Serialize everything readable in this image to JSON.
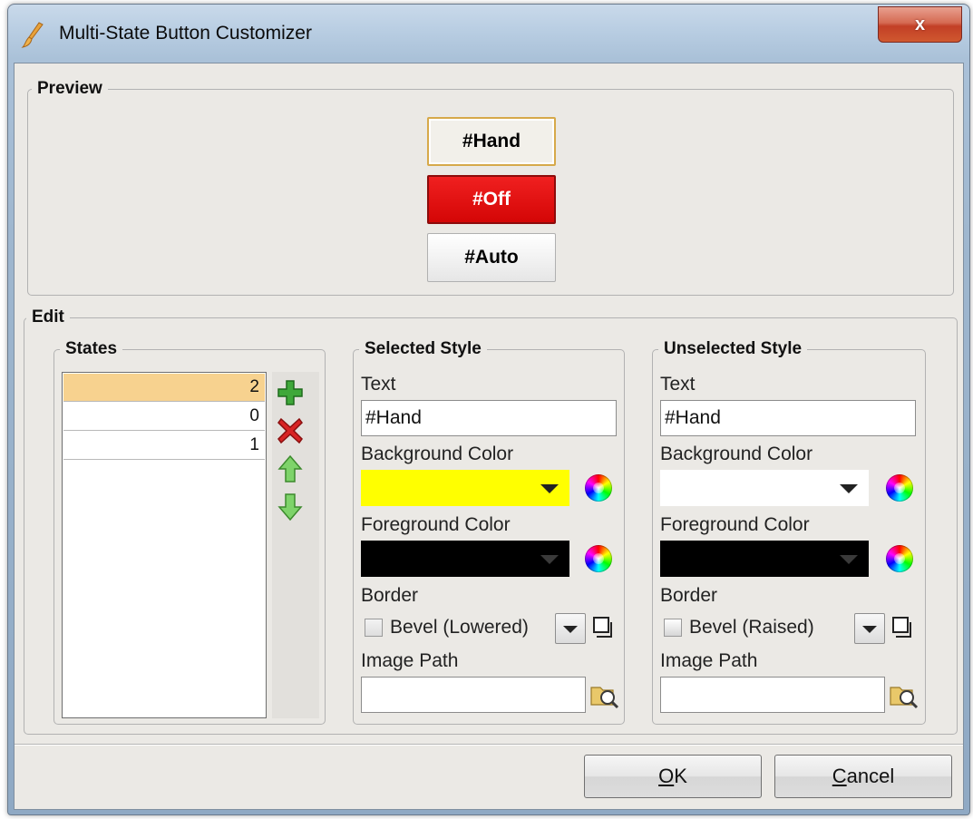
{
  "window": {
    "title": "Multi-State Button Customizer",
    "close_label": "x"
  },
  "preview": {
    "group_title": "Preview",
    "buttons": [
      {
        "label": "#Hand",
        "background": "#f2f0ea",
        "foreground": "#000000",
        "border": "#d6a94a"
      },
      {
        "label": "#Off",
        "background": "#e60c0c",
        "foreground": "#ffffff",
        "border": "#8c0b0b"
      },
      {
        "label": "#Auto",
        "background": "#f4f4f4",
        "foreground": "#000000",
        "border": "#b0b0b0"
      }
    ]
  },
  "edit": {
    "group_title": "Edit",
    "states": {
      "group_title": "States",
      "rows": [
        "2",
        "0",
        "1"
      ],
      "selected_index": 0,
      "actions": [
        "add-icon",
        "delete-icon",
        "move-up-icon",
        "move-down-icon"
      ]
    },
    "selected_style": {
      "group_title": "Selected Style",
      "text_label": "Text",
      "text_value": "#Hand",
      "background_label": "Background Color",
      "background_color": "#ffff00",
      "foreground_label": "Foreground Color",
      "foreground_color": "#000000",
      "border_label": "Border",
      "border_value": "Bevel (Lowered)",
      "image_path_label": "Image Path",
      "image_path_value": ""
    },
    "unselected_style": {
      "group_title": "Unselected Style",
      "text_label": "Text",
      "text_value": "#Hand",
      "background_label": "Background Color",
      "background_color": "#ffffff",
      "foreground_label": "Foreground Color",
      "foreground_color": "#000000",
      "border_label": "Border",
      "border_value": "Bevel (Raised)",
      "image_path_label": "Image Path",
      "image_path_value": ""
    }
  },
  "footer": {
    "ok_mnemonic": "O",
    "ok_rest": "K",
    "cancel_mnemonic": "C",
    "cancel_rest": "ancel"
  }
}
